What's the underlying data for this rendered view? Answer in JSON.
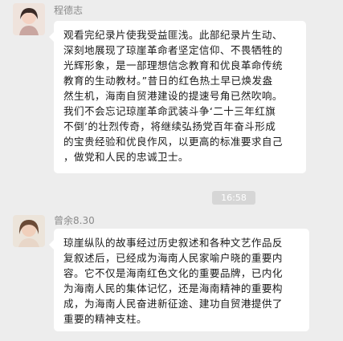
{
  "messages": [
    {
      "sender": "程德志",
      "lines": [
        "观看完纪录片使我受益匪浅。此部纪录片生动、",
        "深刻地展现了琼崖革命者坚定信仰、不畏牺牲的",
        "光辉形象，是一部理想信念教育和优良革命传统",
        "教育的生动教材。”昔日的红色热土早已焕发盎",
        "然生机，海南自贸港建设的提速号角已然吹响。",
        "我们不会忘记琼崖革命武装斗争‘二十三年红旗",
        "不倒’的壮烈传奇，将继续弘扬党百年奋斗形成",
        "的宝贵经验和优良作风，以更高的标准要求自己",
        "，做党和人民的忠诚卫士。"
      ]
    },
    {
      "sender": "曾余8.30",
      "lines": [
        "琼崖纵队的故事经过历史叙述和各种文艺作品反",
        "复叙述后，已经成为海南人民家喻户晓的重要内",
        "容。它不仅是海南红色文化的重要品牌，已内化",
        "为海南人民的集体记忆，还是海南精神的重要构",
        "成，为海南人民奋进新征途、建功自贸港提供了",
        "重要的精神支柱。"
      ]
    }
  ],
  "timestamp": "16:58"
}
